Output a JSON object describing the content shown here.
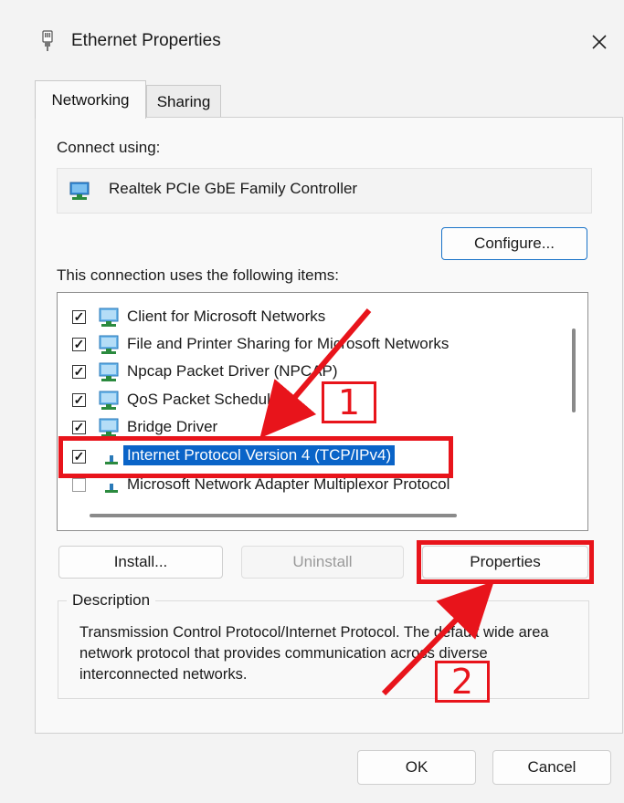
{
  "window": {
    "title": "Ethernet Properties",
    "icon": "ethernet-icon",
    "close_glyph": "✕"
  },
  "tabs": [
    {
      "label": "Networking",
      "active": true
    },
    {
      "label": "Sharing",
      "active": false
    }
  ],
  "connect_using": {
    "label": "Connect using:",
    "adapter": "Realtek PCIe GbE Family Controller",
    "configure_label": "Configure..."
  },
  "items": {
    "label": "This connection uses the following items:",
    "list": [
      {
        "label": "Client for Microsoft Networks",
        "checked": true,
        "selected": false,
        "icon": "network-client-icon"
      },
      {
        "label": "File and Printer Sharing for Microsoft Networks",
        "checked": true,
        "selected": false,
        "icon": "network-service-icon"
      },
      {
        "label": "Npcap Packet Driver (NPCAP)",
        "checked": true,
        "selected": false,
        "icon": "network-service-icon"
      },
      {
        "label": "QoS Packet Scheduler",
        "checked": true,
        "selected": false,
        "icon": "network-service-icon"
      },
      {
        "label": "Bridge Driver",
        "checked": true,
        "selected": false,
        "icon": "network-service-icon"
      },
      {
        "label": "Internet Protocol Version 4 (TCP/IPv4)",
        "checked": true,
        "selected": true,
        "icon": "protocol-icon"
      },
      {
        "label": "Microsoft Network Adapter Multiplexor Protocol",
        "checked": false,
        "selected": false,
        "icon": "protocol-icon"
      }
    ]
  },
  "buttons": {
    "install": "Install...",
    "uninstall": "Uninstall",
    "properties": "Properties",
    "ok": "OK",
    "cancel": "Cancel"
  },
  "description": {
    "legend": "Description",
    "text": "Transmission Control Protocol/Internet Protocol. The default wide area network protocol that provides communication across diverse interconnected networks."
  },
  "annotations": {
    "step1": "1",
    "step2": "2",
    "color": "#e8141b"
  },
  "colors": {
    "selection": "#0a64c8",
    "accent_border": "#1a73c8"
  }
}
